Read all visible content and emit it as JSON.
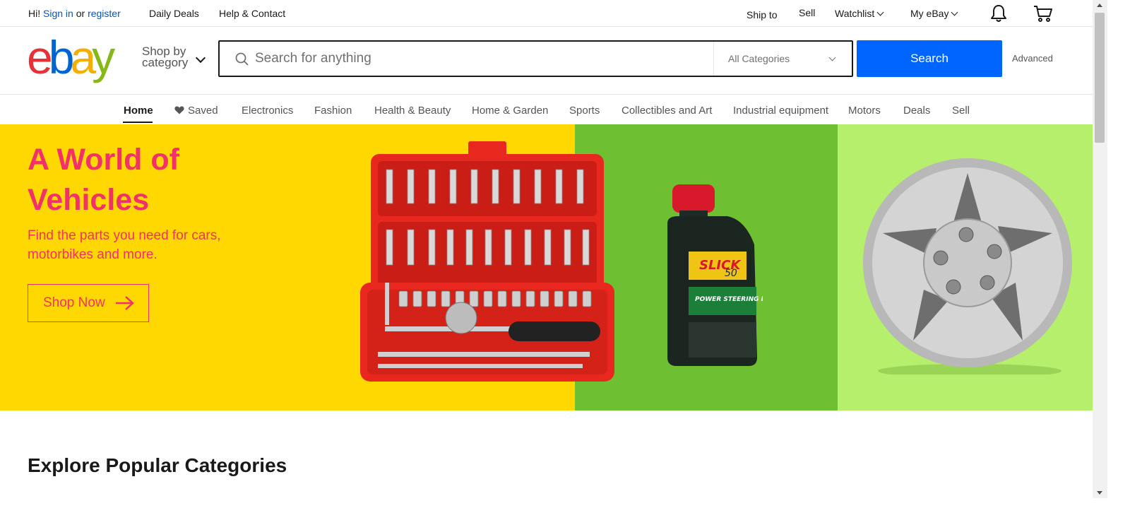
{
  "topbar": {
    "greeting": "Hi!",
    "sign_in": "Sign in",
    "or": "or",
    "register": "register",
    "daily_deals": "Daily Deals",
    "help_contact": "Help & Contact",
    "ship_to": "Ship to",
    "sell": "Sell",
    "watchlist": "Watchlist",
    "my_ebay": "My eBay",
    "notifications_icon": "bell-icon",
    "cart_icon": "cart-icon"
  },
  "header": {
    "logo": "ebay",
    "shop_by_line1": "Shop by",
    "shop_by_line2": "category",
    "search_placeholder": "Search for anything",
    "search_value": "",
    "category_selected": "All Categories",
    "search_button": "Search",
    "advanced": "Advanced"
  },
  "nav": {
    "items": [
      {
        "label": "Home",
        "active": true
      },
      {
        "label": "Saved"
      },
      {
        "label": "Electronics"
      },
      {
        "label": "Fashion"
      },
      {
        "label": "Health & Beauty"
      },
      {
        "label": "Home & Garden"
      },
      {
        "label": "Sports"
      },
      {
        "label": "Collectibles and Art"
      },
      {
        "label": "Industrial equipment"
      },
      {
        "label": "Motors"
      },
      {
        "label": "Deals"
      },
      {
        "label": "Sell"
      }
    ]
  },
  "hero": {
    "title": "A World of Vehicles",
    "subtitle": "Find the parts you need for cars, motorbikes and more.",
    "cta": "Shop Now",
    "bottle_brand": "SLICK",
    "bottle_number": "50",
    "bottle_product": "POWER STEERING FLUID",
    "colors": {
      "yellow": "#fed800",
      "green": "#6fbf33",
      "lime": "#b5ef6b",
      "accent": "#f2316b"
    }
  },
  "sections": {
    "explore_title": "Explore Popular Categories"
  },
  "colors": {
    "link": "#0654ba",
    "search_button": "#0064ff"
  }
}
